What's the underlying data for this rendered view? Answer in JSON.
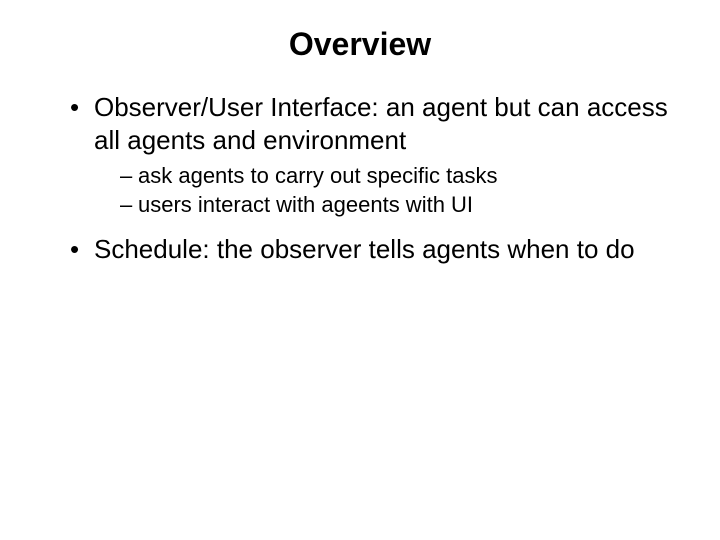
{
  "slide": {
    "title": "Overview",
    "bullets": [
      {
        "text": "Observer/User Interface: an agent but can access all agents and environment",
        "subs": [
          "ask agents to carry out specific tasks",
          "users interact with ageents with UI"
        ]
      },
      {
        "text": "Schedule: the observer tells agents when to do",
        "subs": []
      }
    ]
  }
}
